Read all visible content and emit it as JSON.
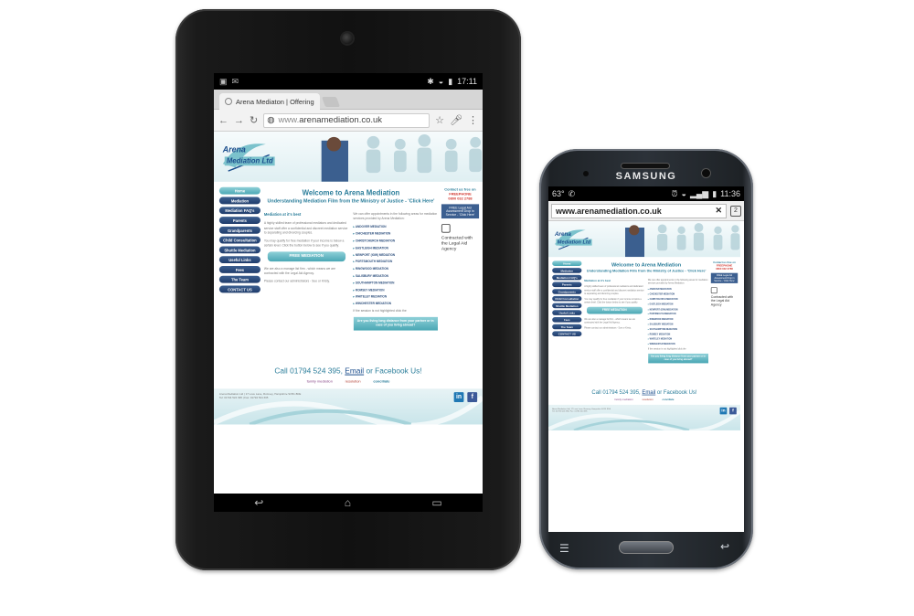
{
  "tablet": {
    "status": {
      "time": "17:11"
    },
    "browser": {
      "tab_title": "Arena Mediaton | Offering",
      "url_prefix": "www.",
      "url_domain": "arenamediation.co.uk"
    }
  },
  "phone": {
    "brand": "SAMSUNG",
    "status": {
      "left": "63°",
      "time": "11:36"
    },
    "browser": {
      "url": "www.arenamediation.co.uk",
      "close": "✕"
    }
  },
  "site": {
    "logo": {
      "line1": "Arena",
      "line2": "Mediation Ltd"
    },
    "nav": [
      "Home",
      "Mediation",
      "Mediation FAQ's",
      "Parents",
      "Grandparents",
      "Child Consultation",
      "Shuttle Mediation",
      "Useful Links",
      "Fees",
      "The Team",
      "CONTACT US"
    ],
    "title": "Welcome to Arena Mediation",
    "subtitle": "Understanding Mediation Film from the Ministry of Justice - 'Click Here'",
    "left_col": {
      "heading": "Mediation at it's best",
      "p1": "A highly skilled team of professional mediators and dedicated service staff offer a confidential and discreet mediation service to separating and divorcing couples.",
      "p2": "You may qualify for free mediation if your income is below a certain level. Click the button below to see if you qualify.",
      "button": "FREE MEDIATION",
      "p3": "We are also a manage list firm - which means we are contracted with the Legal Aid Agency.",
      "p4": "Please contact our administrators - Sue or Kirsty."
    },
    "middle_col": {
      "p1": "We can offer appointments in the following areas for mediation services provided by Arena Mediation:",
      "areas": [
        "ANDOVER MEDIATION",
        "CHICHESTER MEDIATION",
        "CHRISTCHURCH MEDIATION",
        "EASTLEIGH MEDIATION",
        "NEWPORT (IOW) MEDIATION",
        "PORTSMOUTH MEDIATION",
        "RINGWOOD MEDIATION",
        "SALISBURY MEDIATION",
        "SOUTHAMPTON MEDIATION",
        "ROMSEY MEDIATION",
        "WHITELEY MEDIATION",
        "WINCHESTER MEDIATION"
      ],
      "note": "If the session is not highlighted click the",
      "highlight": "Are you living long distance from your partner or in case of you living abroad?"
    },
    "side": {
      "contact": "Contact us free on",
      "freephone_label": "FREEPHONE",
      "freephone": "0800 032 2788",
      "box": "FREE Legal Aid Assessment Drop in Service - 'Click Here'",
      "legal": "Contracted with the Legal Aid Agency"
    },
    "call": {
      "before": "Call 01794 524 395, ",
      "link": "Email",
      "after": " or Facebook Us!"
    },
    "logos": {
      "a": "family mediation",
      "b": "resolution",
      "c": "conciliate"
    },
    "footer": {
      "line1": "Arena Mediation Ltd | 17 Love Lane, Romsey, Hampshire SO51 8DE",
      "line2": "Tel: 01794 524 395 | Fax: 01794 524 395"
    },
    "social": {
      "linkedin": "in",
      "facebook": "f"
    }
  }
}
